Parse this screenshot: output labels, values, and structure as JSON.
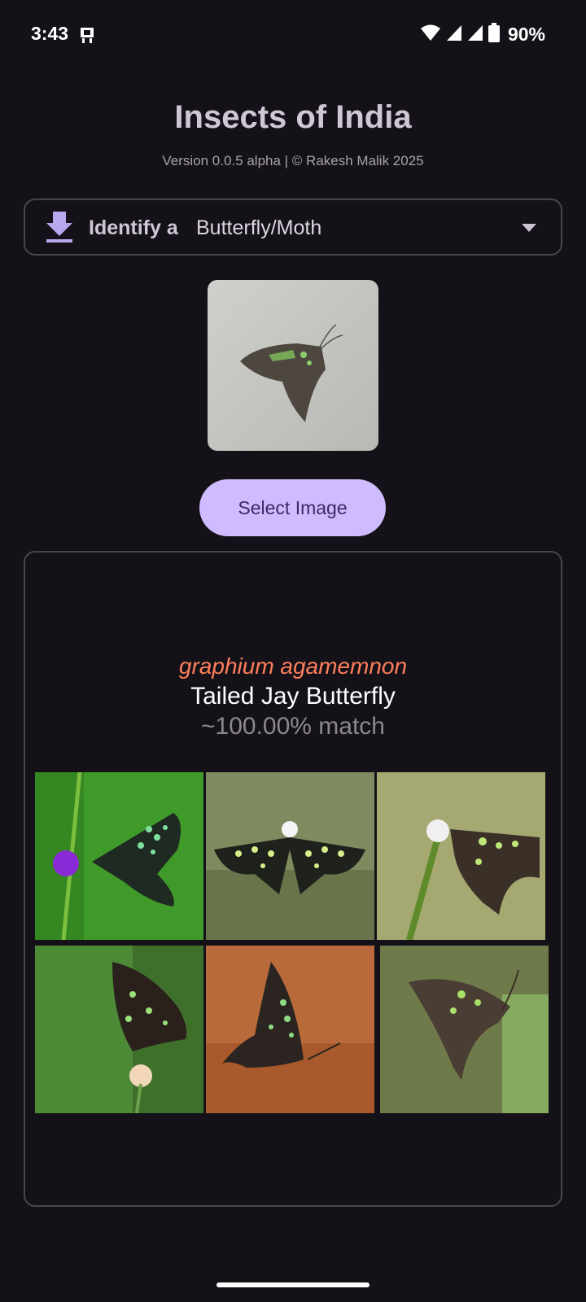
{
  "status": {
    "time": "3:43",
    "battery": "90%"
  },
  "header": {
    "title": "Insects of India",
    "version": "Version 0.0.5 alpha | © Rakesh Malik 2025"
  },
  "identify": {
    "label": "Identify a",
    "selected": "Butterfly/Moth"
  },
  "select_button": {
    "label": "Select Image"
  },
  "result": {
    "scientific_name": "graphium agamemnon",
    "common_name": "Tailed Jay Butterfly",
    "match": "~100.00% match"
  },
  "gallery": [
    {
      "icon": "butterfly-photo-1"
    },
    {
      "icon": "butterfly-photo-2"
    },
    {
      "icon": "butterfly-photo-3"
    },
    {
      "icon": "butterfly-photo-4"
    },
    {
      "icon": "butterfly-photo-5"
    },
    {
      "icon": "butterfly-photo-6"
    }
  ],
  "colors": {
    "background": "#141218",
    "accent": "#cfbcfe",
    "scientific_name": "#ff7f5c",
    "border": "#49454f"
  }
}
